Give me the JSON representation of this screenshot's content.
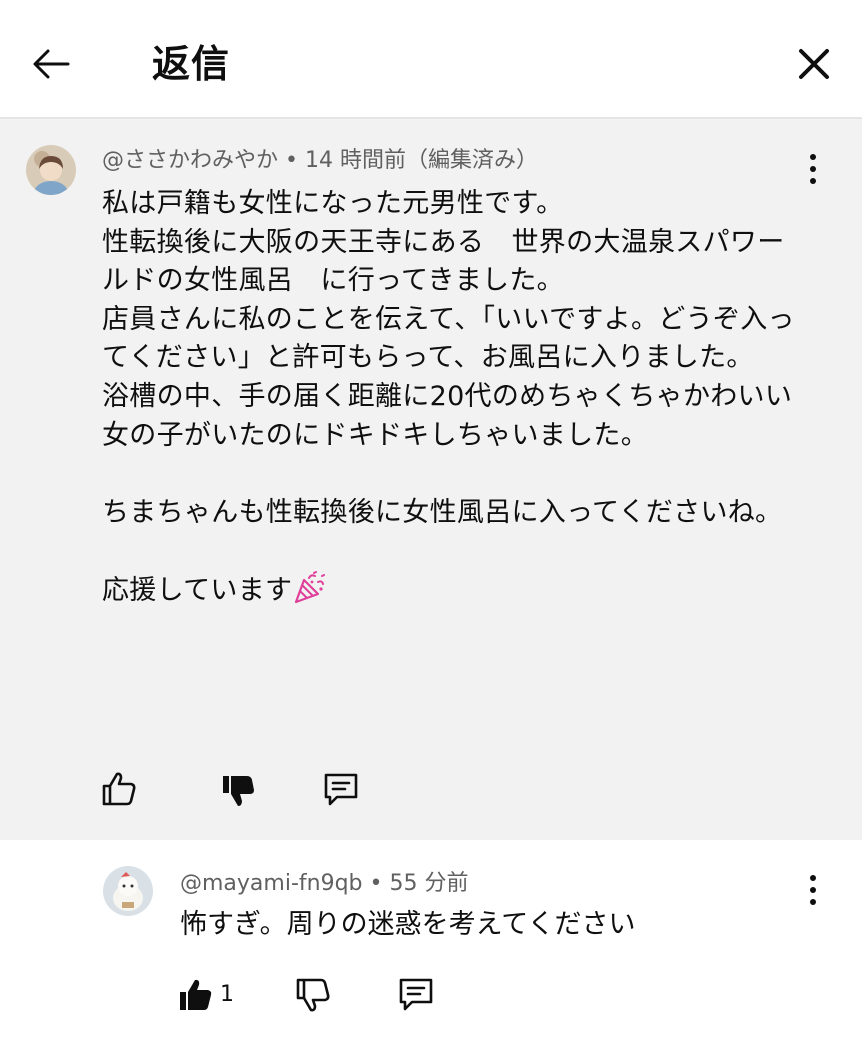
{
  "header": {
    "title": "返信"
  },
  "main_comment": {
    "author": "@ささかわみやか",
    "separator": "•",
    "time": "14 時間前（編集済み）",
    "paragraphs": [
      "私は戸籍も女性になった元男性です。",
      "性転換後に大阪の天王寺にある　世界の大温泉スパワールドの女性風呂　に行ってきました。",
      "店員さんに私のことを伝えて、「いいですよ。どうぞ入ってください」と許可もらって、お風呂に入りました。",
      "浴槽の中、手の届く距離に20代のめちゃくちゃかわいい女の子がいたのにドキドキしちゃいました。",
      "",
      "ちまちゃんも性転換後に女性風呂に入ってくださいね。",
      "",
      "応援しています"
    ],
    "emoji_icon": "party-popper-icon",
    "icons": [
      "like-icon",
      "dislike-filled-icon",
      "reply-icon"
    ]
  },
  "reply": {
    "author": "@mayami-fn9qb",
    "separator": "•",
    "time": "55 分前",
    "text": "怖すぎ。周りの迷惑を考えてください",
    "like_count": "1",
    "icons": [
      "like-filled-icon",
      "dislike-icon",
      "reply-icon"
    ]
  },
  "colors": {
    "comment_bg": "#f2f2f2",
    "meta_text": "#606060",
    "emoji_pink": "#e0409a"
  }
}
